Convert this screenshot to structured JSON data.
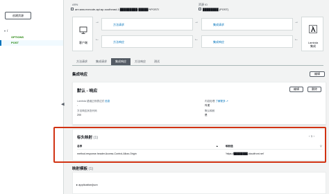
{
  "left": {
    "create_button": "创建资源",
    "root": "/",
    "methods": [
      "OPTIONS",
      "POST"
    ]
  },
  "info": {
    "arn_label": "ARN",
    "arn_value": "arn:aws:execute-api:ap-southeast-1:█████████:█████/*/POST/",
    "resource_id_label": "资源 ID",
    "resource_id_value": "████████ (POST)"
  },
  "flow": {
    "client": "客户端",
    "lambda": "Lambda",
    "lambda_sub": "集成",
    "method_request": "方法请求",
    "integration_request": "集成请求",
    "method_response": "方法响应",
    "integration_response": "集成响应"
  },
  "tabs": [
    "方法请求",
    "集成请求",
    "集成响应",
    "方法响应",
    "测试"
  ],
  "active_tab_index": 2,
  "integration": {
    "title": "集成响应",
    "edit_label": "编辑"
  },
  "default_panel": {
    "title": "默认 - 响应",
    "edit_label": "编辑",
    "delete_label": "删除",
    "lambda_regex_label": "Lambda 错误正则表达式",
    "lambda_regex_info": "信息",
    "lambda_regex_value": "-",
    "content_handling_label": "内容处理",
    "content_handling_link": "了解更多",
    "content_handling_value": "传递",
    "method_status_label": "方法响应状态代码",
    "method_status_value": "200",
    "default_mapping_label": "默认映射",
    "default_mapping_value": "是"
  },
  "header_mappings": {
    "title": "标头映射",
    "count": "(1)",
    "page": "1",
    "col_name": "名称",
    "col_value": "映射值",
    "rows": [
      {
        "name": "method.response.header.Access-Control-Allow-Origin",
        "value": "'https://████████.cloudfront.net'"
      }
    ]
  },
  "mapping_templates": {
    "title": "映射模板",
    "count": "(1)",
    "item": "application/json"
  }
}
